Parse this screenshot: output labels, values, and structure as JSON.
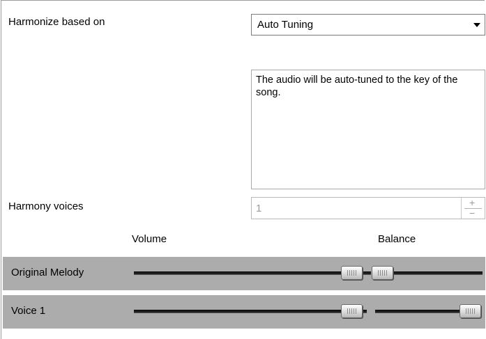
{
  "harmonize": {
    "label": "Harmonize based on",
    "selected": "Auto Tuning",
    "description": "The audio will be auto-tuned to the key of the song."
  },
  "harmony_voices": {
    "label": "Harmony voices",
    "value": "1",
    "plus": "+",
    "minus": "−"
  },
  "headers": {
    "volume": "Volume",
    "balance": "Balance"
  },
  "rows": [
    {
      "name": "Original Melody",
      "volume": 0.95,
      "balance": 0.5
    },
    {
      "name": "Voice 1",
      "volume": 0.95,
      "balance": 1.0
    }
  ],
  "icons": {
    "dropdown": "chevron-down-icon"
  }
}
